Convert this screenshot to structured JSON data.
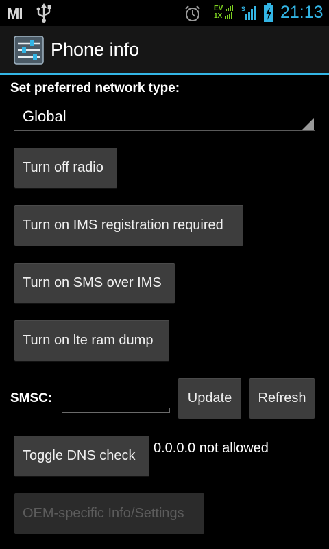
{
  "status_bar": {
    "carrier_logo": "MI",
    "network_top": "EV",
    "network_bottom": "1X",
    "time": "21:13",
    "icons": [
      "usb-icon",
      "alarm-icon",
      "signal-icon",
      "battery-charging-icon"
    ],
    "accent_color": "#33b5e5"
  },
  "action_bar": {
    "title": "Phone info",
    "icon": "settings-sliders-icon"
  },
  "network": {
    "label": "Set preferred network type:",
    "selected": "Global"
  },
  "buttons": {
    "radio": "Turn off radio",
    "ims_registration": "Turn on IMS registration required",
    "sms_over_ims": "Turn on SMS over IMS",
    "lte_ram_dump": "Turn on lte ram dump",
    "update": "Update",
    "refresh": "Refresh",
    "toggle_dns": "Toggle DNS check",
    "oem": "OEM-specific Info/Settings"
  },
  "smsc": {
    "label": "SMSC:",
    "value": ""
  },
  "dns": {
    "status": "0.0.0.0 not allowed"
  }
}
